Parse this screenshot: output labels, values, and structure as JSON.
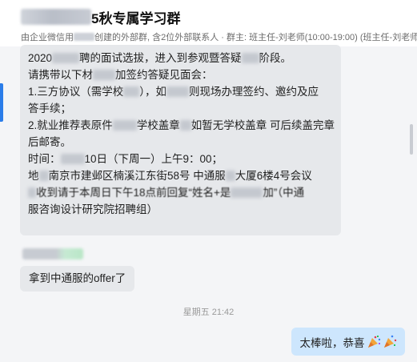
{
  "header": {
    "title": "5秋专属学习群",
    "subtitle_prefix": "由企业微信用",
    "subtitle_rest": "创建的外部群, 含2位外部联系人 · 群主: 班主任-刘老师(10:00-19:00) (班主任-刘老师("
  },
  "messages": {
    "long": {
      "l1a": "2020",
      "l1b": "聘的面试选拔，进入到参观暨答疑",
      "l1c": "阶段。",
      "l2a": "请携带以下材",
      "l2b": "加签约答疑见面会：",
      "l3a": "1.三方协议（需学校",
      "l3b": "），如",
      "l3c": "则现场办理签约、邀约及应",
      "l4": "答手续；",
      "l5a": "2.就业推荐表原件",
      "l5b": "学校盖章",
      "l5c": "如暂无学校盖章 可后续盖完章",
      "l6": "后邮寄。",
      "l7a": "时间：",
      "l7b": "10日（下周一）上午9：00；",
      "l8a": "地",
      "l8b": "南京市建邺区楠溪江东街58号 中通服",
      "l8c": "大厦6楼4号会议",
      "l9a": "收到请于本周日下午18点前回复“姓名+是",
      "l9b": "加”（中通",
      "l10": "服咨询设计研究院招聘组）"
    },
    "offer": "拿到中通服的offer了",
    "timestamp": "星期五 21:42",
    "reply": "太棒啦，恭喜"
  },
  "colors": {
    "accent": "#2b7de9",
    "bubble_left": "#e6e8eb",
    "bubble_right": "#cde6fd",
    "chat_bg": "#f4f5f7"
  }
}
